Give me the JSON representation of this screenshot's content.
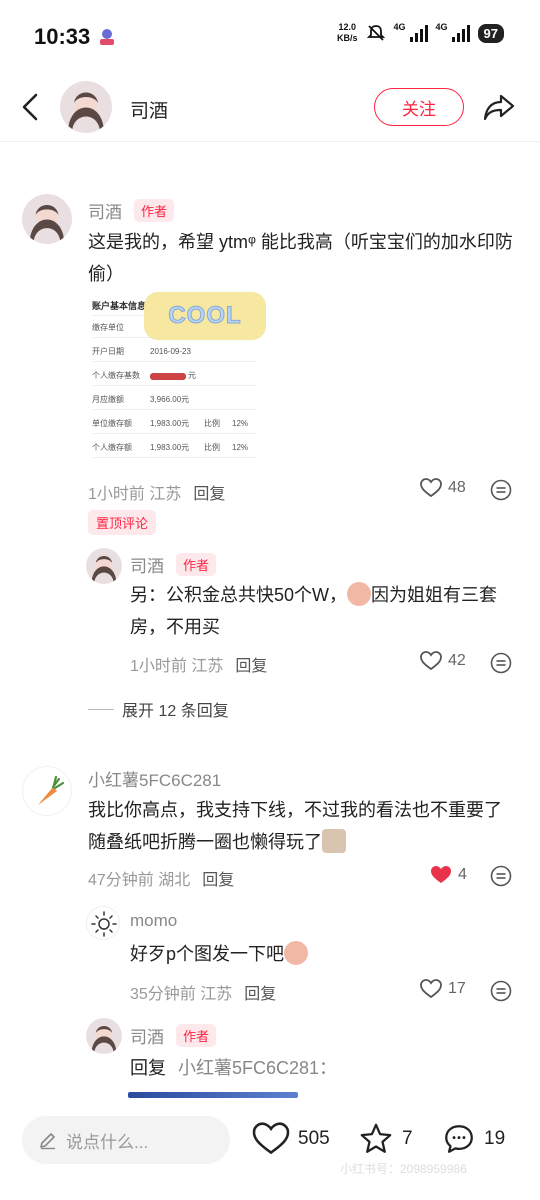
{
  "status_bar": {
    "time": "10:33",
    "speed_value": "12.0",
    "speed_unit": "KB/s",
    "net1": "4G",
    "net2": "4G",
    "battery": "97"
  },
  "header": {
    "name": "司酒",
    "follow_label": "关注"
  },
  "comments": [
    {
      "user": "司酒",
      "tag": "作者",
      "text": "这是我的，希望 ytmᵠ 能比我高（听宝宝们的加水印防偷）",
      "time_location": "1小时前 江苏",
      "reply_label": "回复",
      "likes": "48",
      "pinned_label": "置顶评论",
      "image": {
        "section_title": "账户基本信息",
        "sticker_text": "COOL",
        "rows": [
          {
            "label": "缴存单位",
            "value": ""
          },
          {
            "label": "开户日期",
            "value": "2016-09-23"
          },
          {
            "label": "个人缴存基数",
            "value": "元"
          },
          {
            "label": "月应缴额",
            "value": "3,966.00元"
          },
          {
            "label": "单位缴存额",
            "value": "1,983.00元",
            "extra_label": "比例",
            "extra_value": "12%"
          },
          {
            "label": "个人缴存额",
            "value": "1,983.00元",
            "extra_label": "比例",
            "extra_value": "12%"
          }
        ]
      },
      "replies": [
        {
          "user": "司酒",
          "tag": "作者",
          "text_a": "另：公积金总共快50个W，",
          "text_b": "因为姐姐有三套房，不用买",
          "time_location": "1小时前 江苏",
          "reply_label": "回复",
          "likes": "42"
        }
      ],
      "expand_label": "展开 12 条回复"
    },
    {
      "user": "小红薯5FC6C281",
      "text": "我比你高点，我支持下线，不过我的看法也不重要了随叠纸吧折腾一圈也懒得玩了",
      "time_location": "47分钟前 湖北",
      "reply_label": "回复",
      "likes": "4",
      "replies": [
        {
          "user": "momo",
          "text": "好歹p个图发一下吧",
          "time_location": "35分钟前 江苏",
          "reply_label": "回复",
          "likes": "17"
        },
        {
          "user": "司酒",
          "tag": "作者",
          "reply_prefix": "回复",
          "reply_target": "小红薯5FC6C281："
        }
      ]
    }
  ],
  "bottom_bar": {
    "input_placeholder": "说点什么...",
    "like_count": "505",
    "collect_count": "7",
    "comment_count": "19",
    "watermark": "小红书号：2098959986"
  },
  "colors": {
    "accent": "#ff2442",
    "liked_heart": "#e8334a",
    "author_tag_bg": "#fde9ec"
  }
}
